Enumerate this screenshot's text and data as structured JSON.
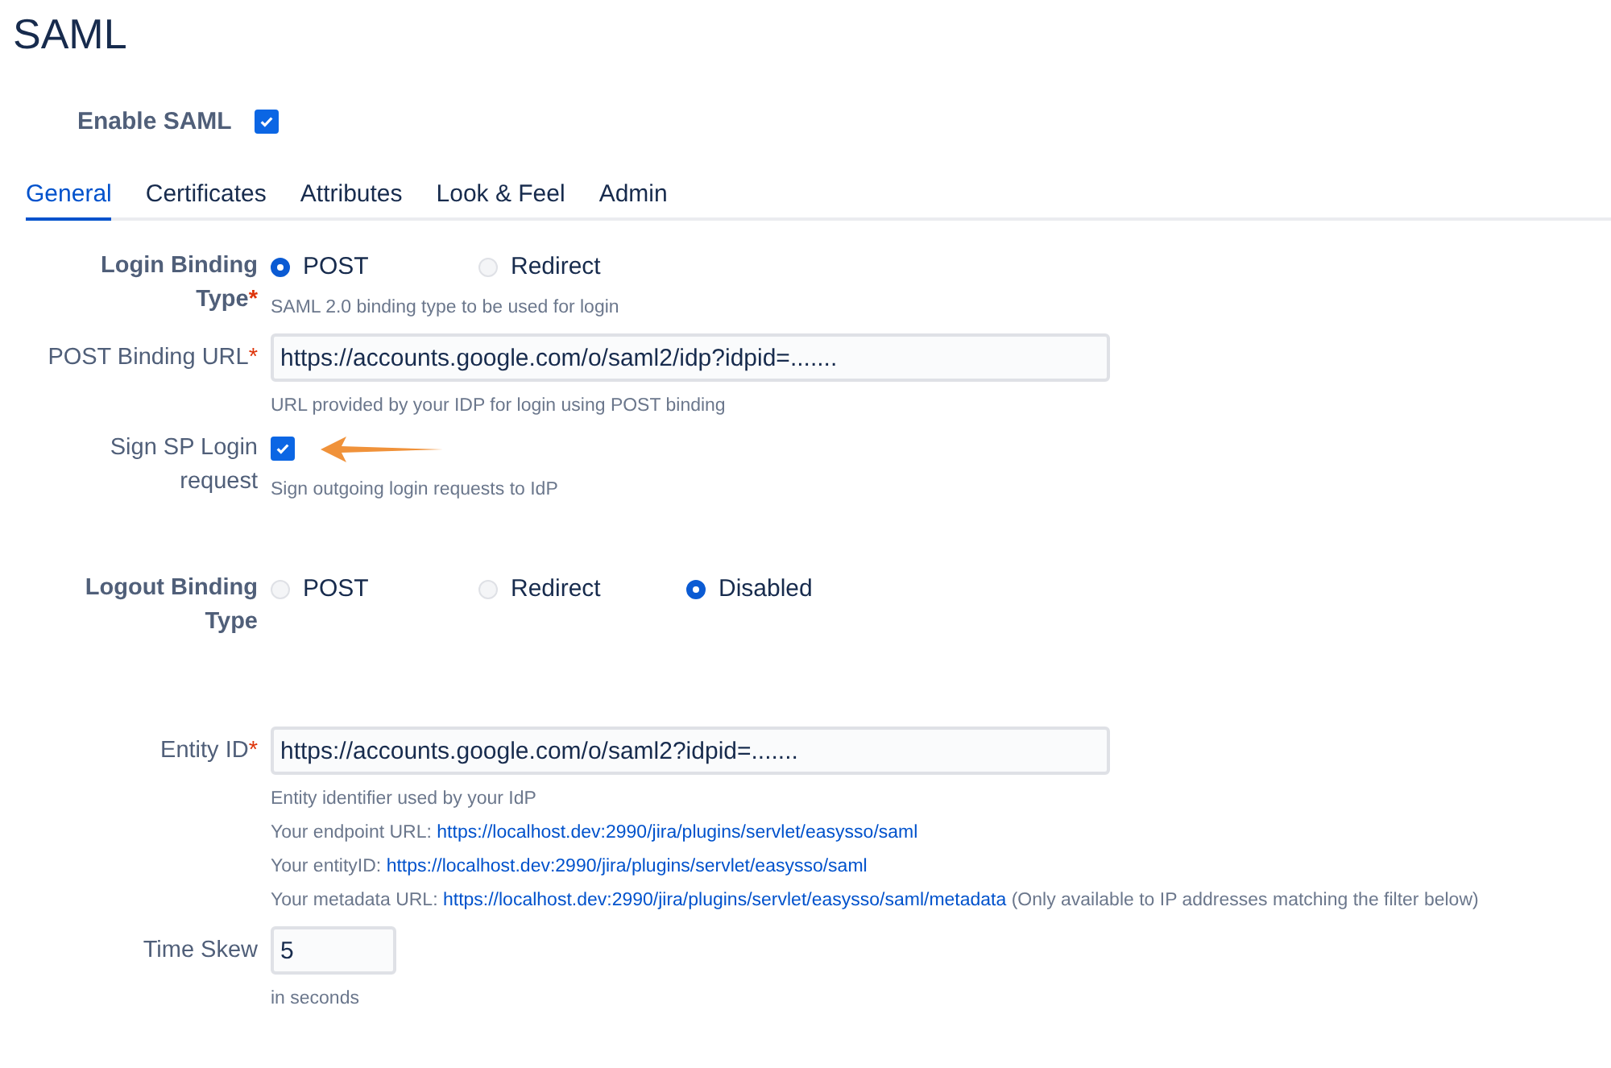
{
  "title": "SAML",
  "enable": {
    "label": "Enable SAML",
    "checked": true
  },
  "tabs": [
    {
      "label": "General",
      "selected": true
    },
    {
      "label": "Certificates",
      "selected": false
    },
    {
      "label": "Attributes",
      "selected": false
    },
    {
      "label": "Look & Feel",
      "selected": false
    },
    {
      "label": "Admin",
      "selected": false
    }
  ],
  "sections": [
    [
      {
        "kind": "radio",
        "label": "Login Binding Type",
        "required_mark": "*",
        "options": [
          {
            "label": "POST",
            "selected": true
          },
          {
            "label": "Redirect",
            "selected": false
          }
        ],
        "help": [
          {
            "text": "SAML 2.0 binding type to be used for login"
          }
        ]
      },
      {
        "kind": "text",
        "label": "POST Binding URL",
        "required_mark": "*",
        "value": "https://accounts.google.com/o/saml2/idp?idpid=.......",
        "help": [
          {
            "text": "URL provided by your IDP for login using POST binding"
          }
        ]
      },
      {
        "kind": "checkbox",
        "label": "Sign SP Login request",
        "checked": true,
        "pointer": true,
        "help": [
          {
            "text": "Sign outgoing login requests to IdP"
          }
        ]
      }
    ],
    [
      {
        "kind": "radio",
        "label": "Logout Binding Type",
        "options": [
          {
            "label": "POST",
            "selected": false
          },
          {
            "label": "Redirect",
            "selected": false
          },
          {
            "label": "Disabled",
            "selected": true
          }
        ]
      }
    ],
    [
      {
        "kind": "text",
        "label": "Entity ID",
        "required_mark": "*",
        "value": "https://accounts.google.com/o/saml2?idpid=.......",
        "help": [
          {
            "text": "Entity identifier used by your IdP"
          },
          {
            "text": "Your endpoint URL:",
            "link": "https://localhost.dev:2990/jira/plugins/servlet/easysso/saml"
          },
          {
            "text": "Your entityID:",
            "link": "https://localhost.dev:2990/jira/plugins/servlet/easysso/saml"
          },
          {
            "text": "Your metadata URL:",
            "link": "https://localhost.dev:2990/jira/plugins/servlet/easysso/saml/metadata",
            "suffix": "(Only available to IP addresses matching the filter below)"
          }
        ]
      },
      {
        "kind": "short",
        "label": "Time Skew",
        "value": "5",
        "help": [
          {
            "text": "in seconds"
          }
        ]
      }
    ]
  ]
}
